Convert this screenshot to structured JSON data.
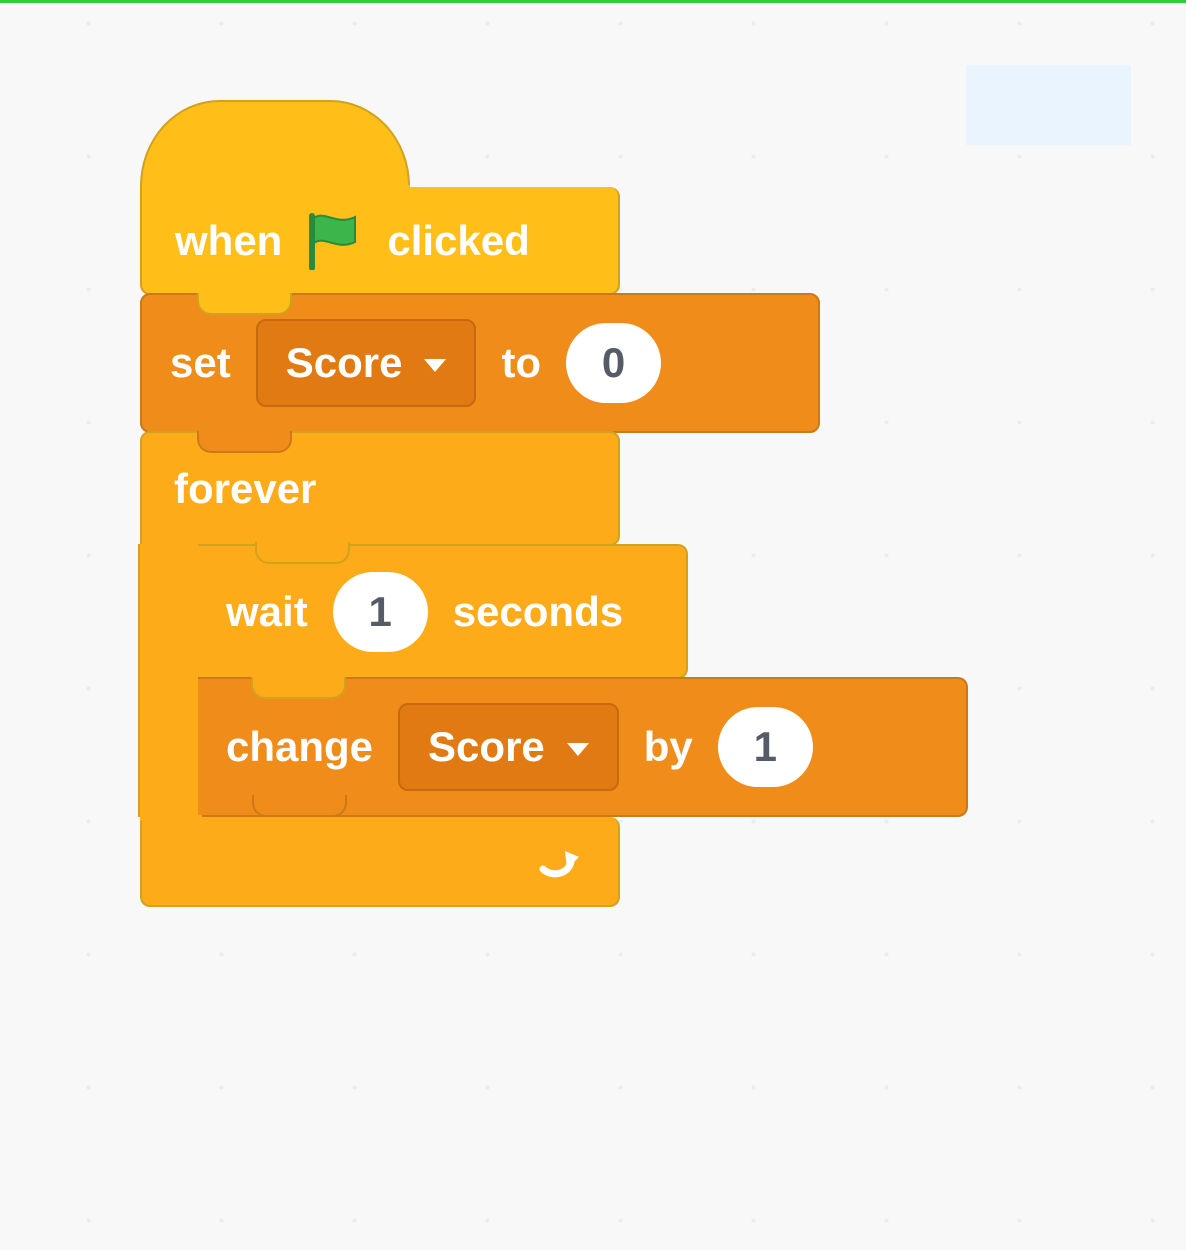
{
  "hat": {
    "prefix": "when",
    "suffix": "clicked"
  },
  "set": {
    "label": "set",
    "variable": "Score",
    "to": "to",
    "value": "0"
  },
  "forever": {
    "label": "forever"
  },
  "wait": {
    "label": "wait",
    "value": "1",
    "unit": "seconds"
  },
  "change": {
    "label": "change",
    "variable": "Score",
    "by": "by",
    "value": "1"
  }
}
